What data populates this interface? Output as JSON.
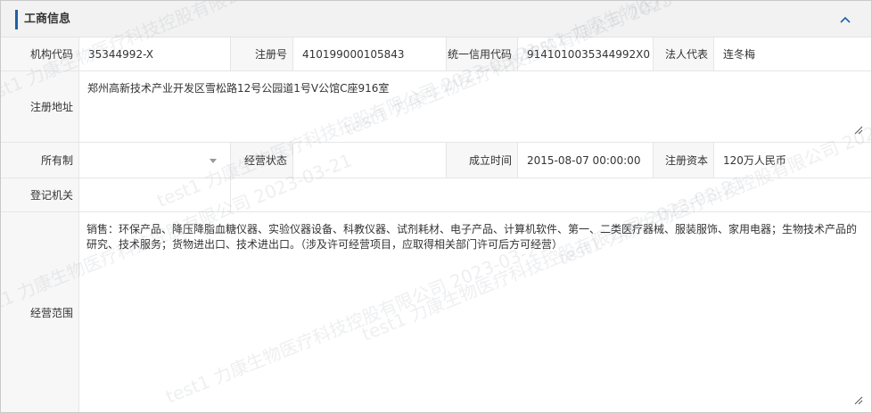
{
  "panel": {
    "title": "工商信息",
    "collapse_icon": "chevron-up-icon",
    "accent_color": "#1f5fa8"
  },
  "fields": {
    "org_code_label": "机构代码",
    "org_code_value": "35344992-X",
    "reg_no_label": "注册号",
    "reg_no_value": "410199000105843",
    "credit_code_label": "统一信用代码",
    "credit_code_value": "9141010035344992X0",
    "legal_rep_label": "法人代表",
    "legal_rep_value": "连冬梅",
    "reg_address_label": "注册地址",
    "reg_address_value": "郑州高新技术产业开发区雪松路12号公园道1号V公馆C座916室",
    "ownership_label": "所有制",
    "ownership_value": "",
    "biz_status_label": "经营状态",
    "biz_status_value": "",
    "established_label": "成立时间",
    "established_value": "2015-08-07 00:00:00",
    "reg_capital_label": "注册资本",
    "reg_capital_value": "120万人民币",
    "reg_authority_label": "登记机关",
    "reg_authority_value": "",
    "biz_scope_label": "经营范围",
    "biz_scope_value": "销售：环保产品、降压降脂血糖仪器、实验仪器设备、科教仪器、试剂耗材、电子产品、计算机软件、第一、二类医疗器械、服装服饰、家用电器；生物技术产品的研究、技术服务；货物进出口、技术进出口。（涉及许可经营项目，应取得相关部门许可后方可经营）"
  },
  "watermark": {
    "text": "test1 力康生物医疗科技控股有限公司 2023-03-21"
  }
}
